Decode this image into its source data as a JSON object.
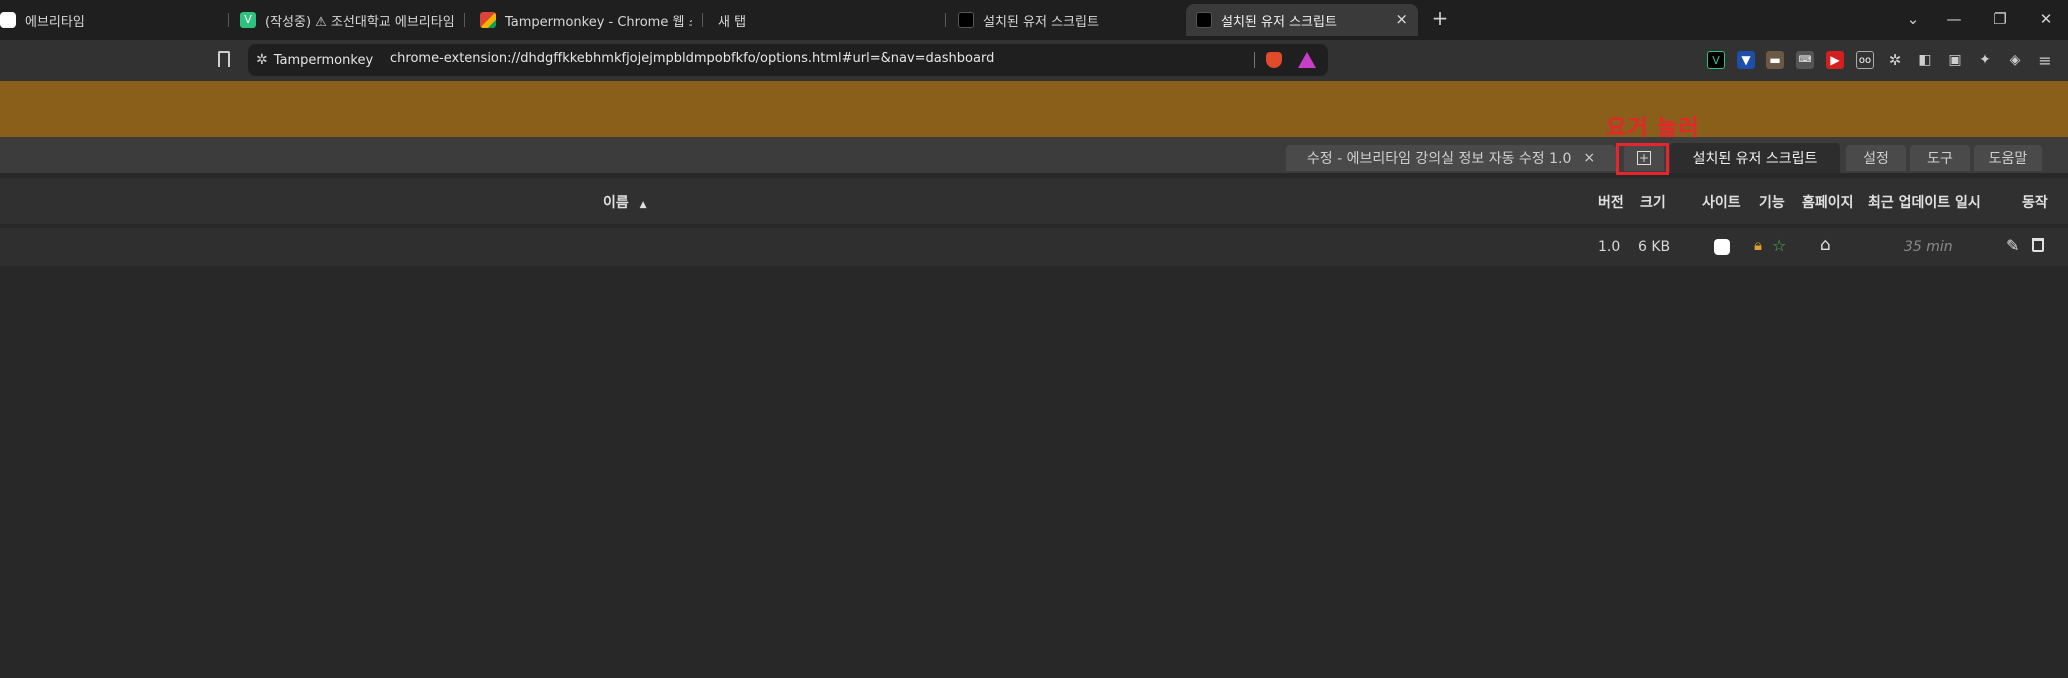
{
  "tabs": [
    {
      "title": "에브리타임"
    },
    {
      "title": "(작성중) ⚠ 조선대학교 에브리타임"
    },
    {
      "title": "Tampermonkey - Chrome 웹 스토어"
    },
    {
      "title": "새 탭"
    },
    {
      "title": "설치된 유저 스크립트"
    },
    {
      "title": "설치된 유저 스크립트",
      "active": true
    }
  ],
  "window": {
    "new_tab": "+",
    "tab_close": "×"
  },
  "address_bar": {
    "site_chip": "Tampermonkey",
    "url": "chrome-extension://dhdgffkkebhmkfjojejmpbldmpobfkfo/options.html#url=&nav=dashboard"
  },
  "tm_tabs": {
    "edit_tab": "수정 - 에브리타임 강의실 정보 자동 수정 1.0",
    "edit_close": "×",
    "installed": "설치된 유저 스크립트",
    "settings": "설정",
    "tools": "도구",
    "help": "도움말"
  },
  "annotation": {
    "label": "요거 눌러"
  },
  "table": {
    "headers": {
      "name": "이름",
      "version": "버전",
      "size": "크기",
      "sites": "사이트",
      "features": "기능",
      "homepage": "홈페이지",
      "last_updated": "최근 업데이트 일시",
      "actions": "동작"
    },
    "rows": [
      {
        "version": "1.0",
        "size": "6 KB",
        "last_updated": "35 min"
      }
    ]
  },
  "colors": {
    "banner": "#8a5f19",
    "annotation": "#e8242c",
    "background": "#282828"
  }
}
